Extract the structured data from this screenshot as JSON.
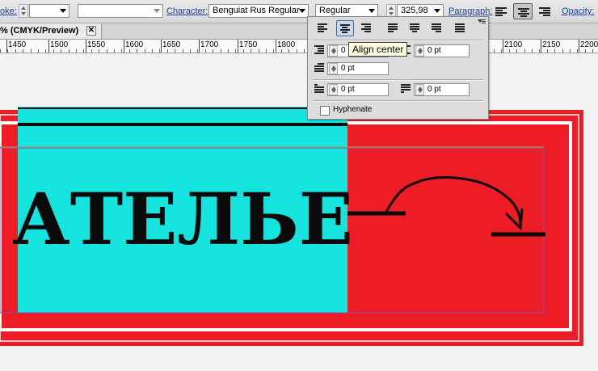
{
  "control_bar": {
    "stroke_label": "oke:",
    "stroke_weight": "",
    "character_label": "Character:",
    "font_family": "Benguiat Rus Regular",
    "font_style": "Regular",
    "font_size": "325,98",
    "paragraph_label": "Paragraph:",
    "opacity_label": "Opacity:"
  },
  "document_tab": {
    "title": "% (CMYK/Preview)",
    "close_glyph": "✕"
  },
  "ruler": {
    "labels": [
      "1450",
      "1500",
      "1550",
      "1600",
      "1650",
      "1700",
      "1750",
      "1800",
      "2100",
      "2150",
      "2200"
    ]
  },
  "paragraph_panel": {
    "tooltip": "Align center",
    "left_indent": "0 pt",
    "right_indent": "0 pt",
    "first_line_indent": "0 pt",
    "space_before": "0 pt",
    "space_after": "0 pt",
    "hyphenate_label": "Hyphenate",
    "hyphenate_checked": false
  },
  "artwork": {
    "main_text": "АТЕЛЬЕ",
    "colors": {
      "background_red": "#ee1c25",
      "panel_cyan": "#15e3dd",
      "border_white": "#ffffff",
      "text_black": "#0a0a0a",
      "guide_purple": "#7b52b8",
      "guide_gold": "#b8a04a"
    }
  },
  "icons": [
    "align-left-icon",
    "align-center-icon",
    "align-right-icon",
    "justify-left-icon",
    "justify-center-icon",
    "justify-right-icon",
    "justify-all-icon",
    "left-indent-icon",
    "right-indent-icon",
    "first-line-indent-icon",
    "space-before-icon",
    "space-after-icon",
    "panel-menu-icon"
  ]
}
